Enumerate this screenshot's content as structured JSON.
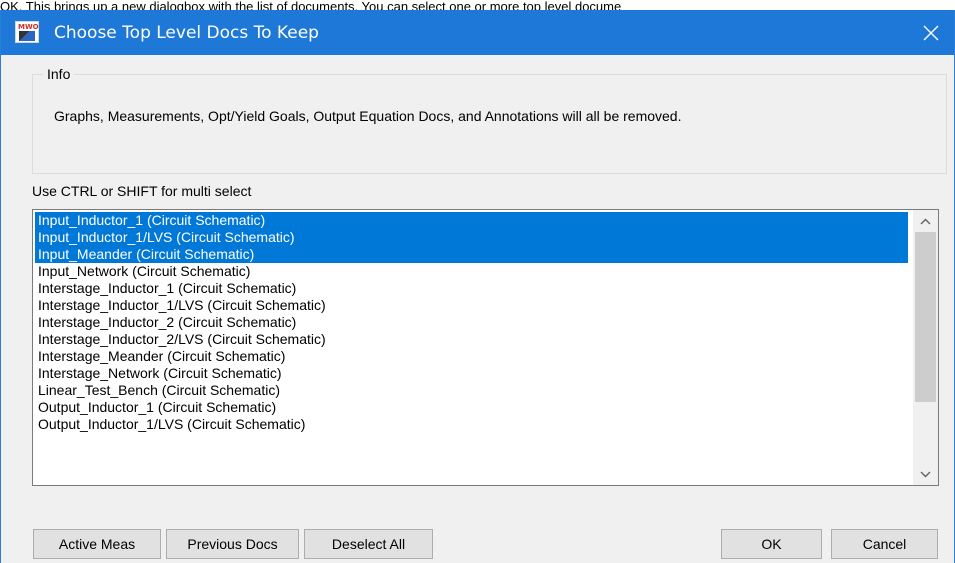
{
  "background_text": "OK. This brings up a new dialogbox with the list of documents. You can select one or more top level docume",
  "dialog": {
    "title": "Choose Top Level Docs To Keep",
    "app_icon": "awr-mwo-app-icon",
    "close_icon": "close-icon",
    "accent_color": "#1e78d7"
  },
  "info": {
    "legend": "Info",
    "text": "Graphs, Measurements, Opt/Yield Goals, Output Equation Docs, and Annotations will all be removed."
  },
  "hint": "Use CTRL or SHIFT for multi select",
  "documents": [
    {
      "label": "Input_Inductor_1 (Circuit Schematic)",
      "selected": true
    },
    {
      "label": "Input_Inductor_1/LVS (Circuit Schematic)",
      "selected": true
    },
    {
      "label": "Input_Meander (Circuit Schematic)",
      "selected": true
    },
    {
      "label": "Input_Network (Circuit Schematic)",
      "selected": false
    },
    {
      "label": "Interstage_Inductor_1 (Circuit Schematic)",
      "selected": false
    },
    {
      "label": "Interstage_Inductor_1/LVS (Circuit Schematic)",
      "selected": false
    },
    {
      "label": "Interstage_Inductor_2 (Circuit Schematic)",
      "selected": false
    },
    {
      "label": "Interstage_Inductor_2/LVS (Circuit Schematic)",
      "selected": false
    },
    {
      "label": "Interstage_Meander (Circuit Schematic)",
      "selected": false
    },
    {
      "label": "Interstage_Network (Circuit Schematic)",
      "selected": false
    },
    {
      "label": "Linear_Test_Bench (Circuit Schematic)",
      "selected": false
    },
    {
      "label": "Output_Inductor_1 (Circuit Schematic)",
      "selected": false
    },
    {
      "label": "Output_Inductor_1/LVS (Circuit Schematic)",
      "selected": false
    }
  ],
  "selection_color": "#0078d7",
  "buttons": {
    "active_meas": "Active Meas",
    "previous_docs": "Previous Docs",
    "deselect_all": "Deselect All",
    "ok": "OK",
    "cancel": "Cancel"
  }
}
